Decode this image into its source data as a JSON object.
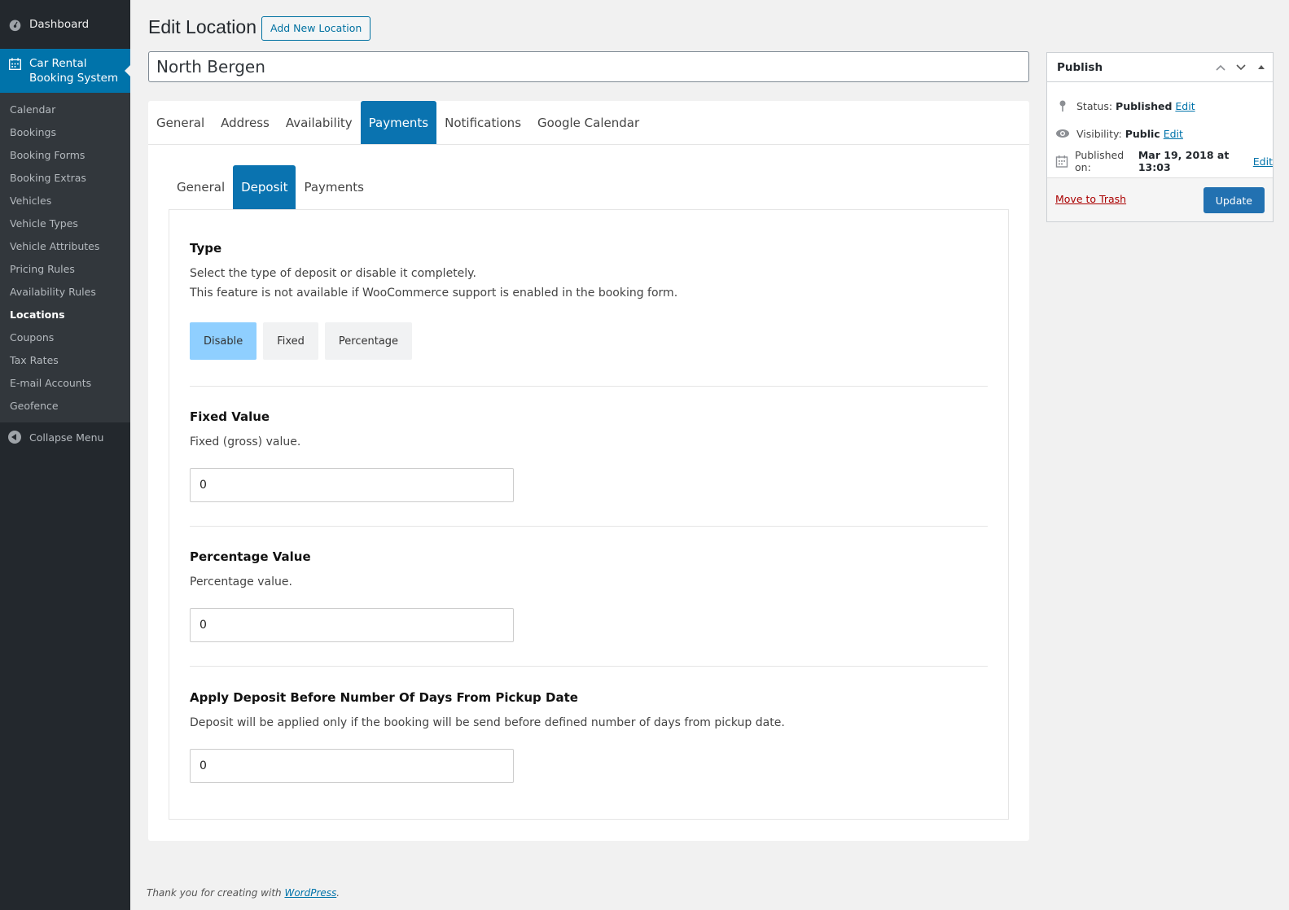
{
  "sidebar": {
    "dashboard": "Dashboard",
    "plugin_line1": "Car Rental",
    "plugin_line2": "Booking System",
    "items": [
      {
        "label": "Calendar"
      },
      {
        "label": "Bookings"
      },
      {
        "label": "Booking Forms"
      },
      {
        "label": "Booking Extras"
      },
      {
        "label": "Vehicles"
      },
      {
        "label": "Vehicle Types"
      },
      {
        "label": "Vehicle Attributes"
      },
      {
        "label": "Pricing Rules"
      },
      {
        "label": "Availability Rules"
      },
      {
        "label": "Locations"
      },
      {
        "label": "Coupons"
      },
      {
        "label": "Tax Rates"
      },
      {
        "label": "E-mail Accounts"
      },
      {
        "label": "Geofence"
      }
    ],
    "active_item": "Locations",
    "collapse": "Collapse Menu"
  },
  "header": {
    "title": "Edit Location",
    "add_new": "Add New Location",
    "post_title": "North Bergen"
  },
  "tabs": [
    "General",
    "Address",
    "Availability",
    "Payments",
    "Notifications",
    "Google Calendar"
  ],
  "active_tab": "Payments",
  "subtabs": [
    "General",
    "Deposit",
    "Payments"
  ],
  "active_subtab": "Deposit",
  "deposit": {
    "type": {
      "title": "Type",
      "desc1": "Select the type of deposit or disable it completely.",
      "desc2": "This feature is not available if WooCommerce support is enabled in the booking form.",
      "options": [
        "Disable",
        "Fixed",
        "Percentage"
      ],
      "selected": "Disable"
    },
    "fixed": {
      "title": "Fixed Value",
      "desc": "Fixed (gross) value.",
      "value": "0"
    },
    "percentage": {
      "title": "Percentage Value",
      "desc": "Percentage value.",
      "value": "0"
    },
    "days": {
      "title": "Apply Deposit Before Number Of Days From Pickup Date",
      "desc": "Deposit will be applied only if the booking will be send before defined number of days from pickup date.",
      "value": "0"
    }
  },
  "publish": {
    "title": "Publish",
    "status_label": "Status:",
    "status_value": "Published",
    "visibility_label": "Visibility:",
    "visibility_value": "Public",
    "published_label": "Published on:",
    "published_value": "Mar 19, 2018 at 13:03",
    "edit": "Edit",
    "trash": "Move to Trash",
    "update": "Update"
  },
  "footer": {
    "text": "Thank you for creating with ",
    "link": "WordPress",
    "suffix": "."
  },
  "colors": {
    "sidebar_bg": "#23282d",
    "accent": "#0073aa",
    "tab_active": "#0a73b0",
    "selected_option": "#8fcfff"
  }
}
